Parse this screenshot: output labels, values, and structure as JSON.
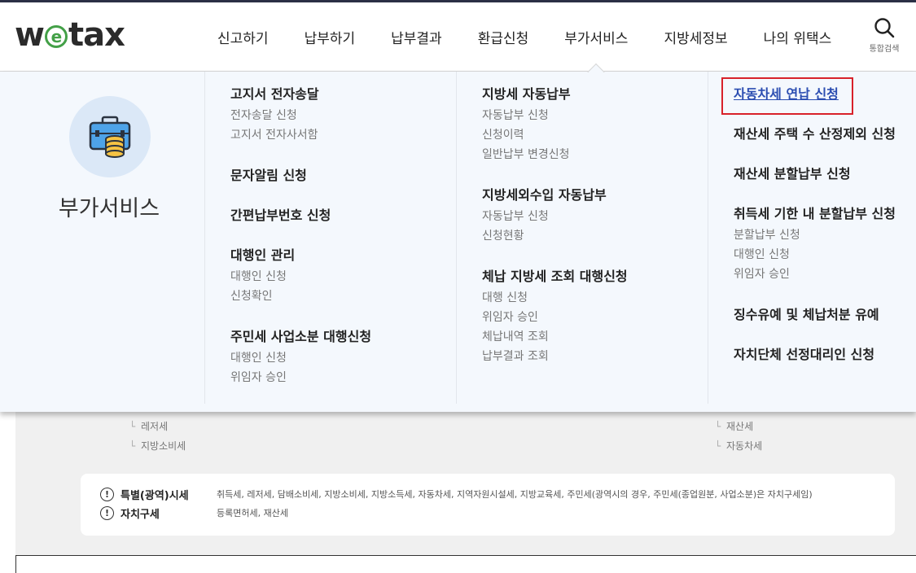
{
  "header": {
    "logo": {
      "w": "w",
      "e": "e",
      "rest": "tax"
    },
    "nav": [
      {
        "label": "신고하기"
      },
      {
        "label": "납부하기"
      },
      {
        "label": "납부결과"
      },
      {
        "label": "환급신청"
      },
      {
        "label": "부가서비스",
        "active": true
      },
      {
        "label": "지방세정보"
      },
      {
        "label": "나의 위택스"
      }
    ],
    "search": {
      "label": "통합검색",
      "icon": "search-icon"
    }
  },
  "mega": {
    "title": "부가서비스",
    "icon": "briefcase-coins-icon",
    "col1": [
      {
        "title": "고지서 전자송달",
        "items": [
          "전자송달 신청",
          "고지서 전자사서함"
        ]
      },
      {
        "title": "문자알림 신청",
        "items": []
      },
      {
        "title": "간편납부번호 신청",
        "items": []
      },
      {
        "title": "대행인 관리",
        "items": [
          "대행인 신청",
          "신청확인"
        ]
      },
      {
        "title": "주민세 사업소분 대행신청",
        "items": [
          "대행인 신청",
          "위임자 승인"
        ]
      }
    ],
    "col2": [
      {
        "title": "지방세 자동납부",
        "items": [
          "자동납부 신청",
          "신청이력",
          "일반납부 변경신청"
        ]
      },
      {
        "title": "지방세외수입 자동납부",
        "items": [
          "자동납부 신청",
          "신청현황"
        ]
      },
      {
        "title": "체납 지방세 조회 대행신청",
        "items": [
          "대행 신청",
          "위임자 승인",
          "체납내역 조회",
          "납부결과 조회"
        ]
      }
    ],
    "col3": [
      {
        "title": "자동차세 연납 신청",
        "items": [],
        "highlighted": true
      },
      {
        "title": "재산세 주택 수 산정제외 신청",
        "items": []
      },
      {
        "title": "재산세 분할납부 신청",
        "items": []
      },
      {
        "title": "취득세 기한 내 분할납부 신청",
        "items": [
          "분할납부 신청",
          "대행인 신청",
          "위임자 승인"
        ]
      },
      {
        "title": "징수유예 및 체납처분 유예",
        "items": []
      },
      {
        "title": "자치단체 선정대리인 신청",
        "items": []
      }
    ]
  },
  "background": {
    "tree_left": [
      "레저세",
      "지방소비세"
    ],
    "tree_right": [
      "재산세",
      "자동차세"
    ],
    "info": [
      {
        "label": "특별(광역)시세",
        "text": "취득세, 레저세, 담배소비세, 지방소비세, 지방소득세, 자동차세, 지역자원시설세, 지방교육세, 주민세(광역시의 경우, 주민세(종업원분, 사업소분)은 자치구세임)"
      },
      {
        "label": "자치구세",
        "text": "등록면허세, 재산세"
      }
    ],
    "info_icon": "!"
  },
  "colors": {
    "accent_red": "#d8212a",
    "link_blue": "#2b4db1",
    "logo_green": "#43a047",
    "panel_bg": "#f4f8fd"
  }
}
